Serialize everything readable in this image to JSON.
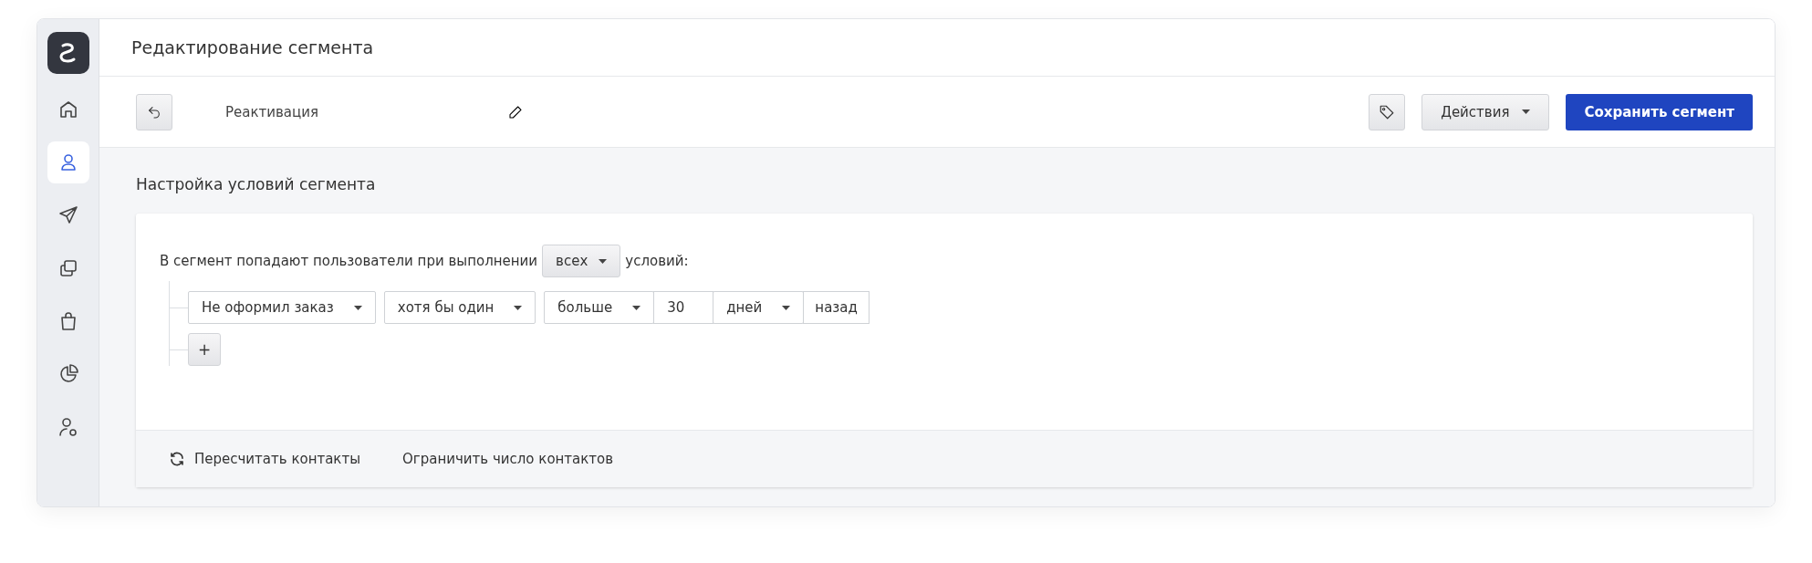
{
  "header": {
    "title": "Редактирование сегмента"
  },
  "sidebar": {
    "items": [
      {
        "selected": false
      },
      {
        "selected": true
      },
      {
        "selected": false
      },
      {
        "selected": false
      },
      {
        "selected": false
      },
      {
        "selected": false
      },
      {
        "selected": false
      }
    ]
  },
  "toolbar": {
    "segment_name": "Реактивация",
    "actions_label": "Действия",
    "save_label": "Сохранить сегмент"
  },
  "section": {
    "title": "Настройка условий сегмента"
  },
  "rule": {
    "prefix": "В сегмент попадают пользователи при выполнении",
    "match": "всех",
    "suffix": "условий:"
  },
  "conditions": [
    {
      "groups": [
        {
          "fields": [
            {
              "kind": "select",
              "value": "Не оформил заказ"
            }
          ]
        },
        {
          "fields": [
            {
              "kind": "select",
              "value": "хотя бы один"
            }
          ]
        },
        {
          "fields": [
            {
              "kind": "select",
              "value": "больше"
            },
            {
              "kind": "input",
              "value": "30"
            },
            {
              "kind": "select",
              "value": "дней"
            },
            {
              "kind": "text",
              "value": "назад"
            }
          ]
        }
      ]
    }
  ],
  "add_label": "+",
  "footer": {
    "recount": "Пересчитать контакты",
    "limit": "Ограничить число контактов"
  }
}
